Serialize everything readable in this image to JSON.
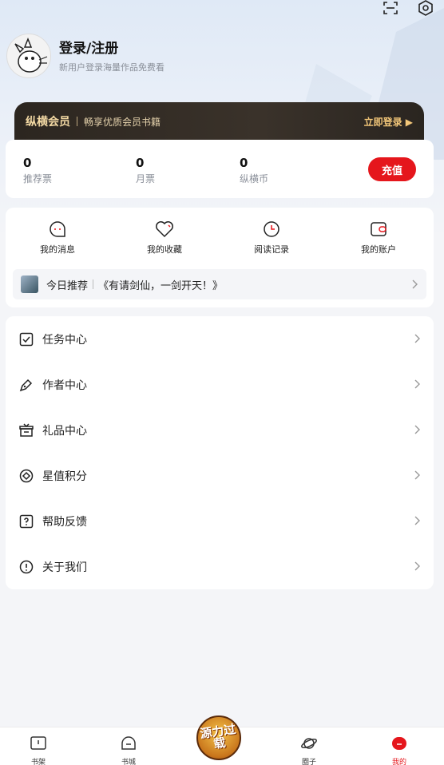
{
  "header": {
    "login_title": "登录/注册",
    "login_subtitle": "新用户登录海量作品免费看",
    "icons": [
      "scan-icon",
      "settings-icon"
    ]
  },
  "vip": {
    "title": "纵横会员",
    "desc": "畅享优质会员书籍",
    "button": "立即登录 ▶",
    "accent": "#f3c779"
  },
  "stats": {
    "items": [
      {
        "value": "0",
        "label": "推荐票"
      },
      {
        "value": "0",
        "label": "月票"
      },
      {
        "value": "0",
        "label": "纵横币"
      }
    ],
    "recharge": "充值",
    "recharge_color": "#e5161c"
  },
  "quick": {
    "items": [
      {
        "label": "我的消息",
        "icon": "message-icon"
      },
      {
        "label": "我的收藏",
        "icon": "heart-icon"
      },
      {
        "label": "阅读记录",
        "icon": "clock-icon"
      },
      {
        "label": "我的账户",
        "icon": "wallet-icon"
      }
    ],
    "recommend_label": "今日推荐",
    "recommend_title": "《有请剑仙，一剑开天！》"
  },
  "menu": {
    "items": [
      {
        "label": "任务中心",
        "icon": "task-icon"
      },
      {
        "label": "作者中心",
        "icon": "pen-icon"
      },
      {
        "label": "礼品中心",
        "icon": "gift-icon"
      },
      {
        "label": "星值积分",
        "icon": "points-icon"
      },
      {
        "label": "帮助反馈",
        "icon": "help-icon"
      },
      {
        "label": "关于我们",
        "icon": "info-icon"
      }
    ]
  },
  "tabbar": {
    "items": [
      {
        "label": "书架",
        "icon": "bookshelf-icon"
      },
      {
        "label": "书城",
        "icon": "bookstore-icon"
      },
      {
        "label": "圈子",
        "icon": "planet-icon"
      },
      {
        "label": "我的",
        "icon": "profile-icon"
      }
    ],
    "center_text": "源力过载",
    "active_color": "#e5161c"
  }
}
